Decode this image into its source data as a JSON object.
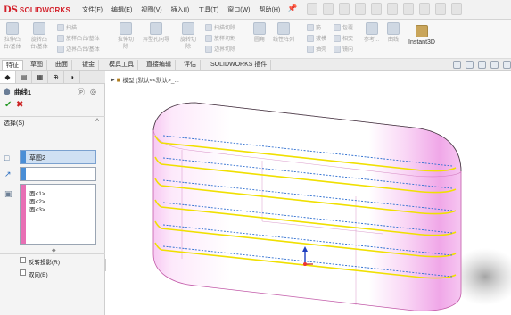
{
  "app": {
    "logo_ds": "DS",
    "logo_text": "SOLIDWORKS",
    "menus": [
      "文件(F)",
      "编辑(E)",
      "视图(V)",
      "插入(I)",
      "工具(T)",
      "窗口(W)",
      "帮助(H)"
    ]
  },
  "ribbon": {
    "groups": [
      {
        "label_top": "扫描",
        "label_bottom": "扫描切除"
      },
      {
        "label_top": "放样凸台/基体",
        "label_bottom": "放样切割"
      },
      {
        "label_top": "边界凸台/基体",
        "label_bottom": "边界切除"
      }
    ],
    "col1": [
      "拉伸凸",
      "台/基体"
    ],
    "col2": [
      "旋转凸",
      "台/基体"
    ],
    "col3": [
      "拉伸切",
      "除"
    ],
    "col4": [
      "异型孔向导"
    ],
    "col5": [
      "旋转切",
      "除"
    ],
    "col6": [
      "圆角",
      "线性阵列"
    ],
    "col7": [
      "筋",
      "拔模",
      "抽壳"
    ],
    "col8": [
      "包覆",
      "相交",
      "镜向"
    ],
    "col9": [
      "参考...",
      "曲线"
    ],
    "instant3d": "Instant3D"
  },
  "tabs": [
    {
      "label": "特征",
      "active": true
    },
    {
      "label": "草图",
      "active": false
    },
    {
      "label": "曲面",
      "active": false
    },
    {
      "label": "钣金",
      "active": false
    },
    {
      "label": "模具工具",
      "active": false
    },
    {
      "label": "直接编辑",
      "active": false
    },
    {
      "label": "评估",
      "active": false
    },
    {
      "label": "SOLIDWORKS 插件",
      "active": false
    }
  ],
  "panel": {
    "title": "曲线1",
    "selection_label": "选择(S)",
    "profile_value": "草图2",
    "faces": [
      "面<1>",
      "面<2>",
      "面<3>"
    ],
    "reverse_projection": "反转投影(R)",
    "bidirectional": "双向(B)"
  },
  "breadcrumb": {
    "text": "模型 (默认<<默认>_..."
  },
  "colors": {
    "accent_blue": "#4a8ed6",
    "face_pink": "#e86fb4",
    "curve_yellow": "#f0e000",
    "model_body": "#f8d3f4",
    "model_edge": "#c25aa8"
  }
}
